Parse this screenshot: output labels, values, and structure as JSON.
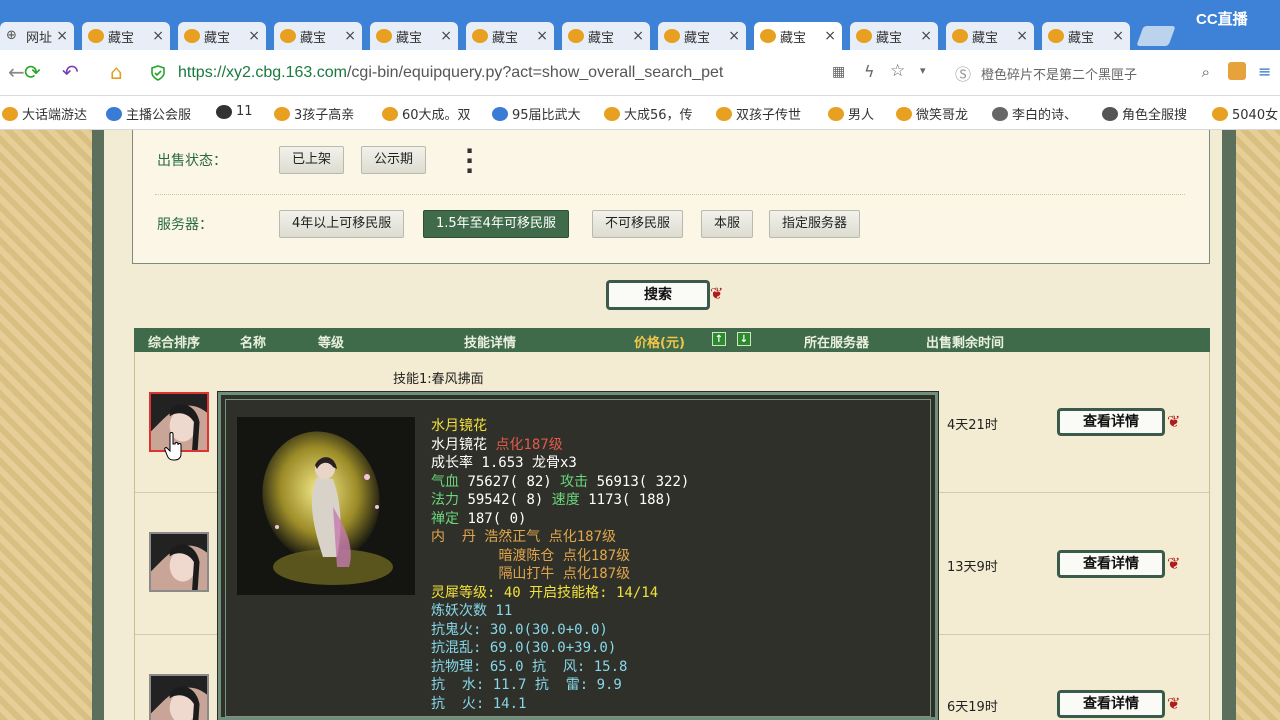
{
  "browser": {
    "tabs": [
      {
        "title": "网址"
      },
      {
        "title": "藏宝"
      },
      {
        "title": "藏宝"
      },
      {
        "title": "藏宝"
      },
      {
        "title": "藏宝"
      },
      {
        "title": "藏宝"
      },
      {
        "title": "藏宝"
      },
      {
        "title": "藏宝"
      },
      {
        "title": "藏宝",
        "active": true
      },
      {
        "title": "藏宝"
      },
      {
        "title": "藏宝"
      },
      {
        "title": "藏宝"
      }
    ],
    "brand": "CC直播",
    "url_main": "https://xy2.cbg.163.com",
    "url_path": "/cgi-bin/equipquery.py?act=show_overall_search_pet",
    "search_placeholder": "橙色碎片不是第二个黑匣子",
    "bookmarks": [
      "大话端游达",
      "主播公会服",
      "11",
      "3孩子高亲",
      "60大成。双",
      "95届比武大",
      "大成56，传",
      "双孩子传世",
      "男人",
      "微笑哥龙",
      "李白的诗、",
      "角色全服搜",
      "5040女"
    ]
  },
  "filters": {
    "status_label": "出售状态：",
    "status_options": [
      "已上架",
      "公示期"
    ],
    "server_label": "服务器：",
    "server_options": [
      "4年以上可移民服",
      "1.5年至4年可移民服",
      "不可移民服",
      "本服",
      "指定服务器"
    ],
    "server_selected": "1.5年至4年可移民服"
  },
  "search_button": "搜索",
  "table": {
    "headers": {
      "sort": "综合排序",
      "name": "名称",
      "level": "等级",
      "skills": "技能详情",
      "price": "价格(元)",
      "server": "所在服务器",
      "time": "出售剩余时间"
    },
    "arrow_up": "↑",
    "arrow_down": "↓",
    "detail_label": "查看详情",
    "rows": [
      {
        "skill": "技能1:春风拂面",
        "time": "4天21时"
      },
      {
        "skill": "",
        "time": "13天9时"
      },
      {
        "skill": "",
        "time": "6天19时"
      }
    ]
  },
  "popup": {
    "name": "水月镜花",
    "line2_name": "水月镜花",
    "line2_tag": "点化187级",
    "growth": "成长率 1.653 龙骨x3",
    "hp_label": "气血",
    "hp": "75627( 82)",
    "atk_label": "攻击",
    "atk": "56913( 322)",
    "mp_label": "法力",
    "mp": "59542( 8)",
    "spd_label": "速度",
    "spd": "1173( 188)",
    "focus_label": "禅定",
    "focus": "187( 0)",
    "neidan_label": "内  丹",
    "neidan": [
      "浩然正气 点化187级",
      "暗渡陈仓 点化187级",
      "隔山打牛 点化187级"
    ],
    "lingxi": "灵犀等级: 40 开启技能格: 14/14",
    "lianyao": "炼妖次数 11",
    "res1": "抗鬼火: 30.0(30.0+0.0)",
    "res2": "抗混乱: 69.0(30.0+39.0)",
    "res3": "抗物理: 65.0 抗  风: 15.8",
    "res4": "抗  水: 11.7 抗  雷: 9.9",
    "res5": "抗  火: 14.1"
  }
}
